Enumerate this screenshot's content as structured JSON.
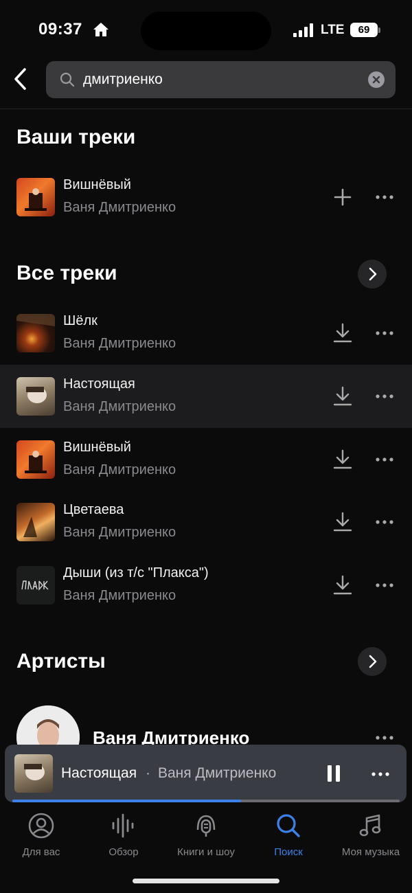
{
  "status_bar": {
    "time": "09:37",
    "network": "LTE",
    "battery": "69"
  },
  "search": {
    "query": "дмитриенко"
  },
  "your_tracks": {
    "title": "Ваши треки",
    "items": [
      {
        "title": "Вишнёвый",
        "artist": "Ваня Дмитриенко",
        "action_icon": "plus-icon"
      }
    ]
  },
  "all_tracks": {
    "title": "Все треки",
    "items": [
      {
        "title": "Шёлк",
        "artist": "Ваня Дмитриенко",
        "action_icon": "download-icon"
      },
      {
        "title": "Настоящая",
        "artist": "Ваня Дмитриенко",
        "action_icon": "download-icon",
        "active": true
      },
      {
        "title": "Вишнёвый",
        "artist": "Ваня Дмитриенко",
        "action_icon": "download-icon"
      },
      {
        "title": "Цветаева",
        "artist": "Ваня Дмитриенко",
        "action_icon": "download-icon"
      },
      {
        "title": "Дыши (из т/с \"Плакса\")",
        "artist": "Ваня Дмитриенко",
        "action_icon": "download-icon"
      }
    ]
  },
  "artists": {
    "title": "Артисты",
    "items": [
      {
        "name": "Ваня Дмитриенко"
      }
    ]
  },
  "mini_player": {
    "title": "Настоящая",
    "separator": "·",
    "artist": "Ваня Дмитриенко",
    "progress": 0.59
  },
  "tabs": [
    {
      "label": "Для вас",
      "icon": "profile-icon"
    },
    {
      "label": "Обзор",
      "icon": "waveform-icon"
    },
    {
      "label": "Книги и шоу",
      "icon": "podcast-mic-icon"
    },
    {
      "label": "Поиск",
      "icon": "search-icon",
      "active": true
    },
    {
      "label": "Моя музыка",
      "icon": "music-note-icon"
    }
  ],
  "colors": {
    "accent": "#3b82e8",
    "background": "#0b0b0c",
    "mini_player_bg": "#3a3c44"
  }
}
